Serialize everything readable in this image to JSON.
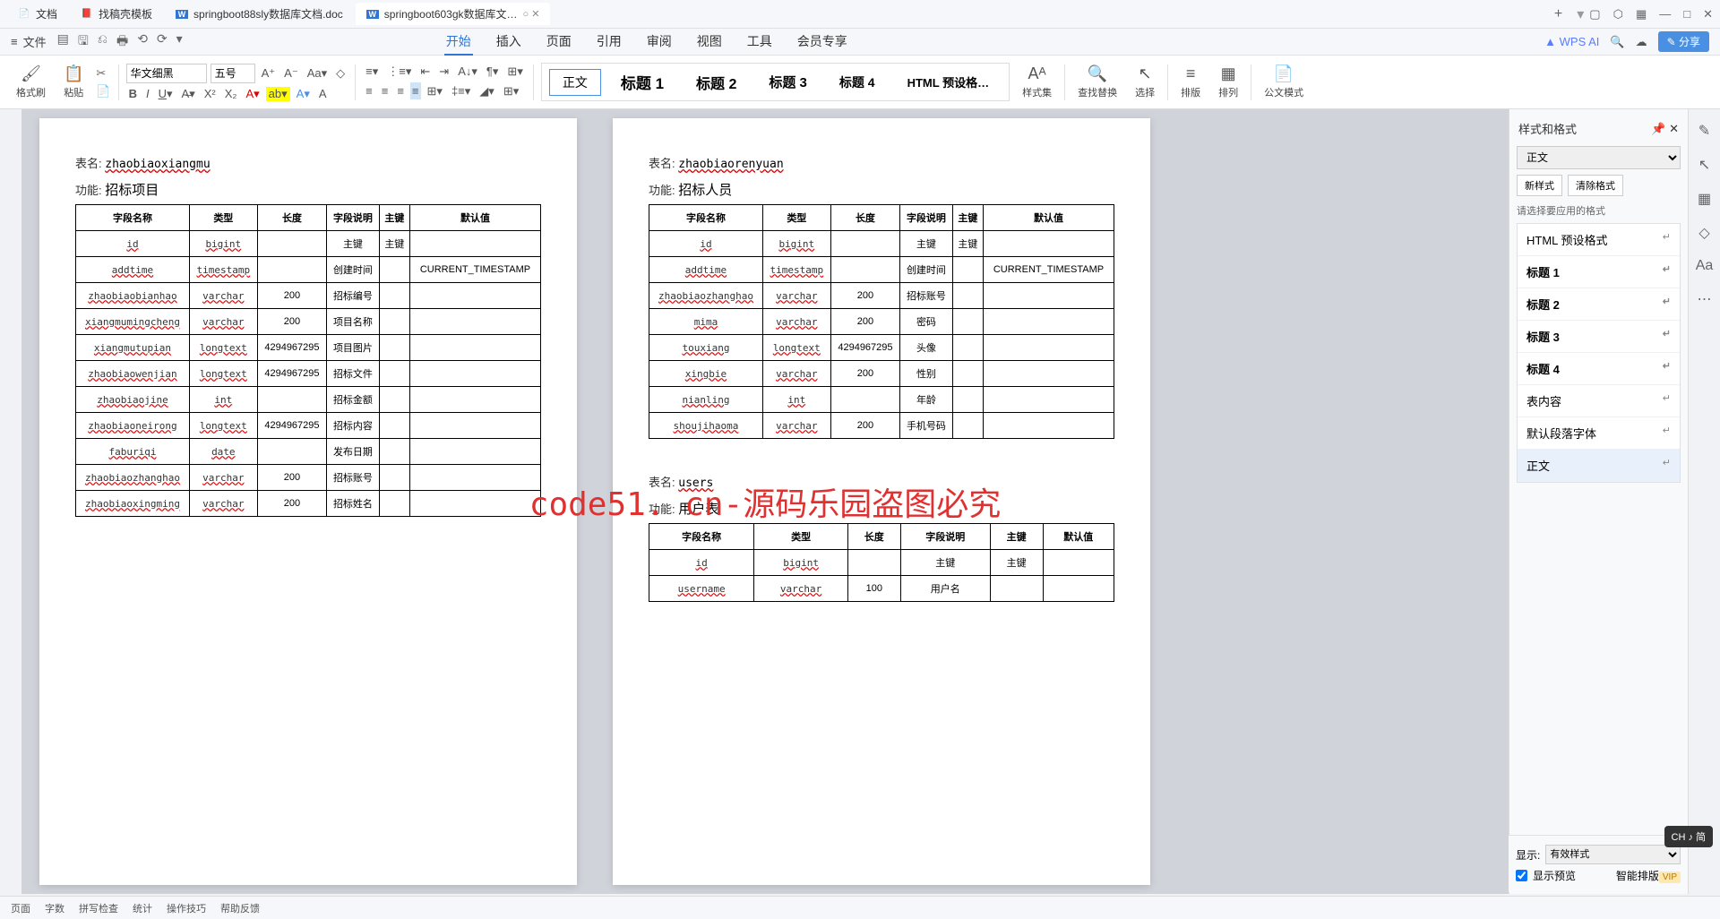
{
  "titlebar": {
    "tabs": [
      {
        "icon": "📄",
        "label": "文档",
        "color": "#2e75d6"
      },
      {
        "icon": "📕",
        "label": "找稿壳模板",
        "color": "#d04030"
      },
      {
        "icon": "W",
        "label": "springboot88sly数据库文档.doc",
        "color": "#2e75d6"
      },
      {
        "icon": "W",
        "label": "springboot603gk数据库文…",
        "color": "#2e75d6",
        "active": true
      }
    ],
    "newtab": "+",
    "right": [
      "▢",
      "⬡",
      "▦",
      "—",
      "□",
      "✕"
    ]
  },
  "menubar": {
    "file": "文件",
    "quick": [
      "▤",
      "🖫",
      "⎌",
      "🖶",
      "⟲",
      "⟳",
      "▾"
    ],
    "menus": [
      "开始",
      "插入",
      "页面",
      "引用",
      "审阅",
      "视图",
      "工具",
      "会员专享"
    ],
    "active": "开始",
    "wpsai": "WPS AI",
    "search": "🔍",
    "cloud": "☁",
    "share": "✎ 分享"
  },
  "ribbon": {
    "fmtbrush": "格式刷",
    "paste": "粘贴",
    "cut": "✂",
    "fontname": "华文细黑",
    "fontsize": "五号",
    "stylelabels": [
      "正文",
      "标题 1",
      "标题 2",
      "标题 3",
      "标题 4",
      "HTML 预设格…"
    ],
    "styleset": "样式集",
    "findreplace": "查找替换",
    "select": "选择",
    "outline": "排版",
    "arrange": "排列",
    "gongwen": "公文模式"
  },
  "page1": {
    "tablename_k": "表名:",
    "tablename_v": "zhaobiaoxiangmu",
    "func_k": "功能:",
    "func_v": "招标项目",
    "headers": [
      "字段名称",
      "类型",
      "长度",
      "字段说明",
      "主键",
      "默认值"
    ],
    "rows": [
      [
        "id",
        "bigint",
        "",
        "主键",
        "主键",
        ""
      ],
      [
        "addtime",
        "timestamp",
        "",
        "创建时间",
        "",
        "CURRENT_TIMESTAMP"
      ],
      [
        "zhaobiaobianhao",
        "varchar",
        "200",
        "招标编号",
        "",
        ""
      ],
      [
        "xiangmumingcheng",
        "varchar",
        "200",
        "项目名称",
        "",
        ""
      ],
      [
        "xiangmutupian",
        "longtext",
        "4294967295",
        "项目图片",
        "",
        ""
      ],
      [
        "zhaobiaowenjian",
        "longtext",
        "4294967295",
        "招标文件",
        "",
        ""
      ],
      [
        "zhaobiaojine",
        "int",
        "",
        "招标金额",
        "",
        ""
      ],
      [
        "zhaobiaoneirong",
        "longtext",
        "4294967295",
        "招标内容",
        "",
        ""
      ],
      [
        "faburiqi",
        "date",
        "",
        "发布日期",
        "",
        ""
      ],
      [
        "zhaobiaozhanghao",
        "varchar",
        "200",
        "招标账号",
        "",
        ""
      ],
      [
        "zhaobiaoxingming",
        "varchar",
        "200",
        "招标姓名",
        "",
        ""
      ]
    ]
  },
  "page2a": {
    "tablename_k": "表名:",
    "tablename_v": "zhaobiaorenyuan",
    "func_k": "功能:",
    "func_v": "招标人员",
    "headers": [
      "字段名称",
      "类型",
      "长度",
      "字段说明",
      "主键",
      "默认值"
    ],
    "rows": [
      [
        "id",
        "bigint",
        "",
        "主键",
        "主键",
        ""
      ],
      [
        "addtime",
        "timestamp",
        "",
        "创建时间",
        "",
        "CURRENT_TIMESTAMP"
      ],
      [
        "zhaobiaozhanghao",
        "varchar",
        "200",
        "招标账号",
        "",
        ""
      ],
      [
        "mima",
        "varchar",
        "200",
        "密码",
        "",
        ""
      ],
      [
        "touxiang",
        "longtext",
        "4294967295",
        "头像",
        "",
        ""
      ],
      [
        "xingbie",
        "varchar",
        "200",
        "性别",
        "",
        ""
      ],
      [
        "nianling",
        "int",
        "",
        "年龄",
        "",
        ""
      ],
      [
        "shoujihaoma",
        "varchar",
        "200",
        "手机号码",
        "",
        ""
      ]
    ]
  },
  "page2b": {
    "tablename_k": "表名:",
    "tablename_v": "users",
    "func_k": "功能:",
    "func_v": "用户表",
    "headers": [
      "字段名称",
      "类型",
      "长度",
      "字段说明",
      "主键",
      "默认值"
    ],
    "rows": [
      [
        "id",
        "bigint",
        "",
        "主键",
        "主键",
        ""
      ],
      [
        "username",
        "varchar",
        "100",
        "用户名",
        "",
        ""
      ]
    ]
  },
  "rightpanel": {
    "title": "样式和格式",
    "current": "正文",
    "btn_new": "新样式",
    "btn_clear": "清除格式",
    "hint": "请选择要应用的格式",
    "items": [
      "HTML 预设格式",
      "标题 1",
      "标题 2",
      "标题 3",
      "标题 4",
      "表内容",
      "默认段落字体",
      "正文"
    ],
    "selected": "正文",
    "display_lbl": "显示:",
    "display_val": "有效样式",
    "preview_chk": "显示预览",
    "smart": "智能排版"
  },
  "watermark": "code51. cn-源码乐园盗图必究",
  "ime": "CH ♪ 简",
  "statusbar": {
    "left": [
      "页面",
      "字数",
      "拼写检查",
      "统计",
      "操作技巧",
      "帮助反馈"
    ]
  }
}
